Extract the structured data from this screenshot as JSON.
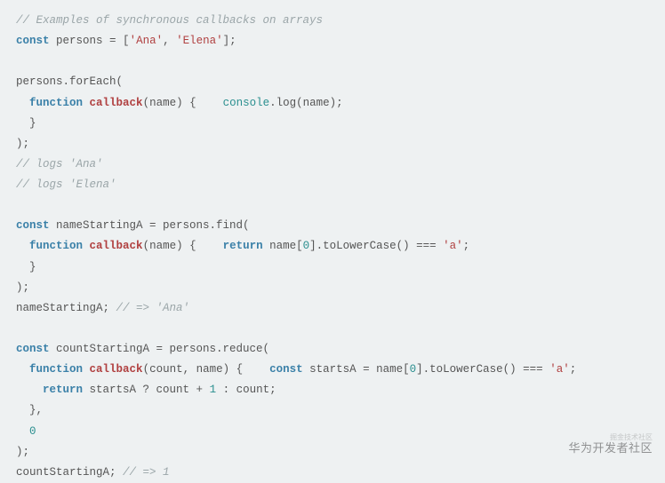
{
  "code": {
    "c1": "// Examples of synchronous callbacks on arrays",
    "kw_const": "const",
    "persons": "persons",
    "eq": " = [",
    "ana": "'Ana'",
    "comma1": ", ",
    "elena": "'Elena'",
    "close_arr": "];",
    "foreach_open": "persons.forEach(",
    "kw_function": "function",
    "callback": "callback",
    "param_name": "(name) {    ",
    "console": "console",
    "log": ".log(name);",
    "brace_close": "  }",
    "paren_close": ");",
    "c2": "// logs 'Ana'",
    "c3": "// logs 'Elena'",
    "nsa": " nameStartingA = persons.find(",
    "return": "return",
    "find_body": " name[",
    "zero": "0",
    "tolower": "].toLowerCase() === ",
    "a_str": "'a'",
    "semi": ";",
    "nsa_line": "nameStartingA; ",
    "c4": "// => 'Ana'",
    "csa": " countStartingA = persons.reduce(",
    "param_count": "(count, name) {    ",
    "startsA": " startsA = name[",
    "return2": "return",
    "ternary": " startsA ? count + ",
    "one": "1",
    "ternary2": " : count;",
    "brace_close2": "  },",
    "zero2": "0",
    "csa_line": "countStartingA; ",
    "c5": "// => 1"
  },
  "watermark": "华为开发者社区",
  "watermark_sub": "掘金技术社区"
}
